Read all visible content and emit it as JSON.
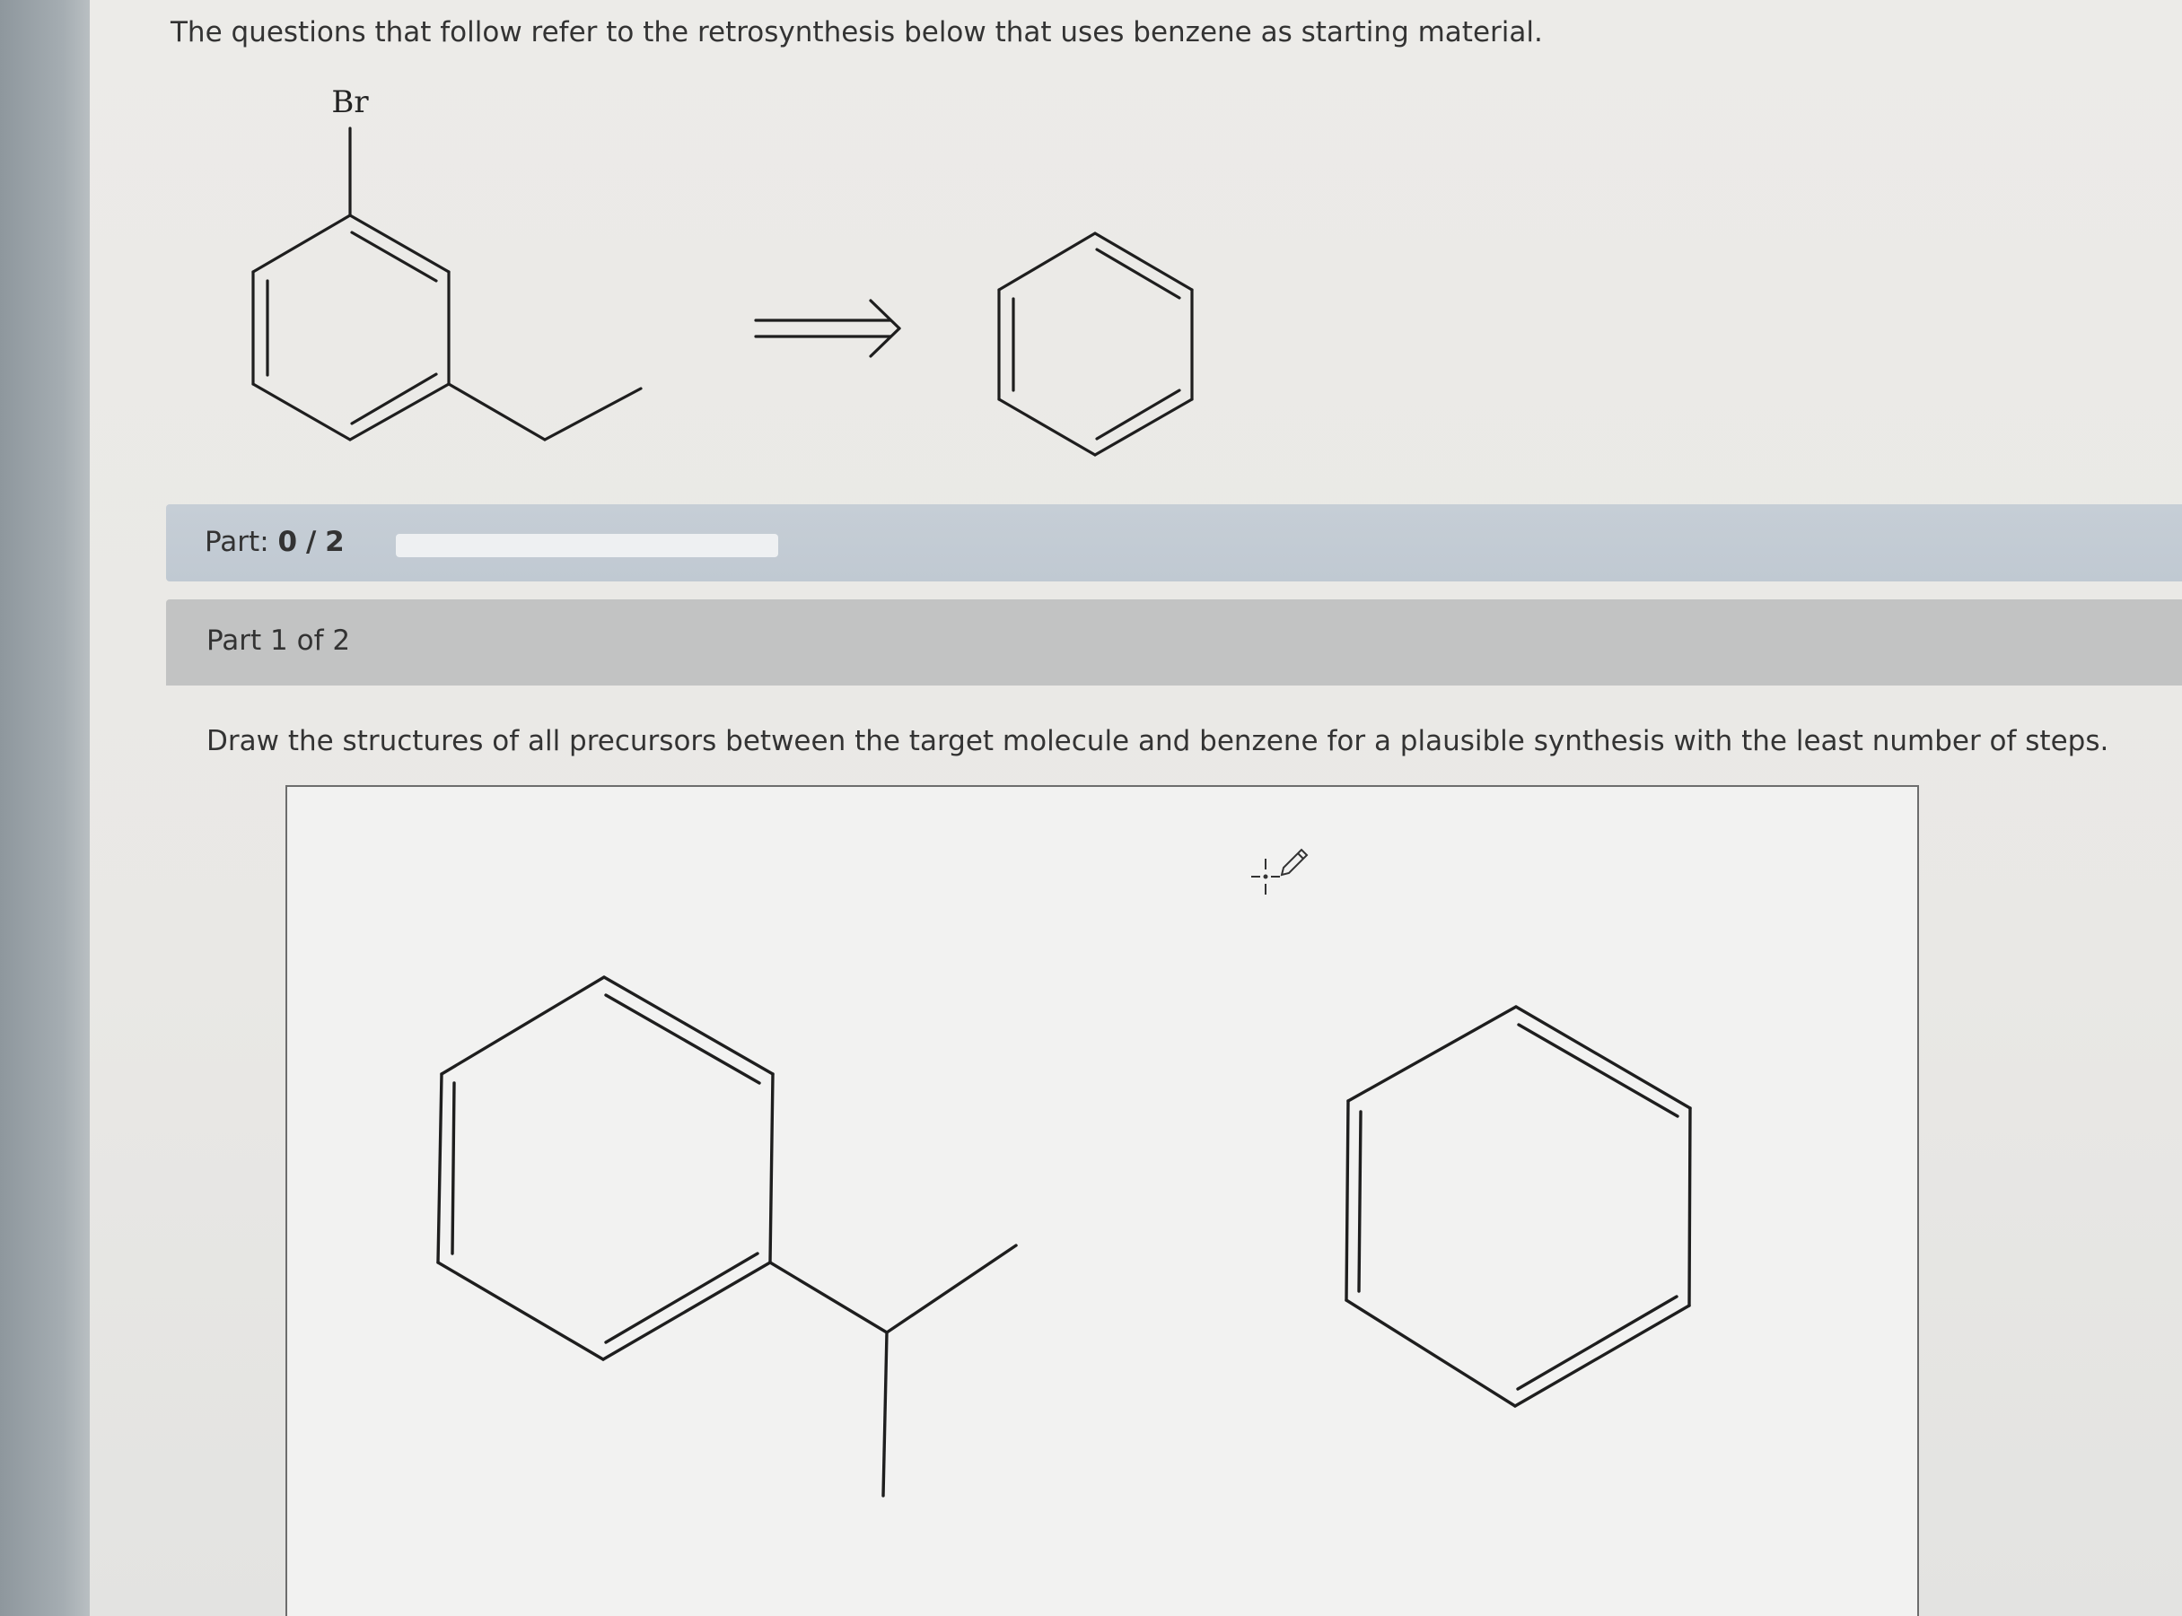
{
  "intro_text": "The questions that follow refer to the retrosynthesis below that uses benzene as starting material.",
  "scheme": {
    "target_label": "Br",
    "arrow": "retrosynthesis-arrow",
    "starting_material": "benzene"
  },
  "part_progress": {
    "label": "Part:",
    "current": "0",
    "separator": "/",
    "total": "2",
    "fraction": 0
  },
  "part_header": "Part 1 of 2",
  "question": "Draw the structures of all precursors between the target molecule and benzene for a plausible synthesis with the least number of steps.",
  "drawing_area": {
    "cursor_icon": "crosshair-pencil-icon"
  },
  "colors": {
    "progress_bar": "#c6ced6",
    "part_header": "#c2c3c3",
    "bond": "#1e1e1e"
  }
}
